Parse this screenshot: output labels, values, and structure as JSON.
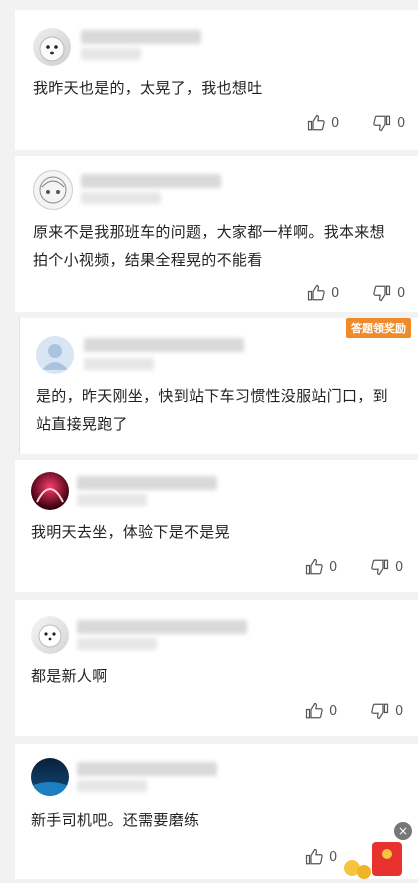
{
  "comments": [
    {
      "text": "我昨天也是的，太晃了，我也想吐",
      "likes": "0",
      "dislikes": "0"
    },
    {
      "text_line1": "原来不是我那班车的问题，大家都一样啊。我本来想",
      "text_line2": "拍个小视频，结果全程晃的不能看",
      "likes": "0",
      "dislikes": "0"
    },
    {
      "text_line1": "是的，昨天刚坐，快到站下车习惯性没服站门口，到",
      "text_line2": "站直接晃跑了",
      "badge": "答题领奖励"
    },
    {
      "text": "我明天去坐，体验下是不是晃",
      "likes": "0",
      "dislikes": "0"
    },
    {
      "text": "都是新人啊",
      "likes": "0",
      "dislikes": "0"
    },
    {
      "text": "新手司机吧。还需要磨练",
      "likes": "0"
    }
  ],
  "colors": {
    "background": "#f2f2f2",
    "card": "#ffffff",
    "badge": "#f08b2b",
    "text": "#222222"
  },
  "icons": {
    "like": "thumbs-up-icon",
    "dislike": "thumbs-down-icon",
    "close": "close-icon",
    "reward": "red-envelope-icon"
  }
}
